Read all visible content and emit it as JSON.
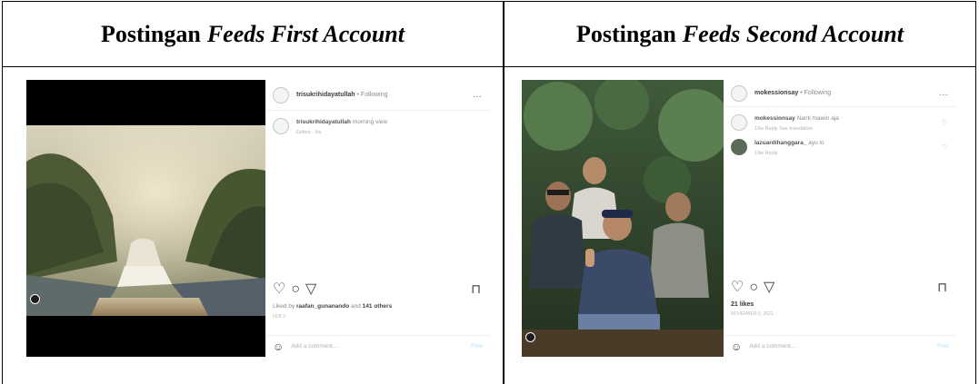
{
  "headers": {
    "col1_prefix": "Postingan",
    "col1_italic": "Feeds First Account",
    "col2_prefix": "Postingan",
    "col2_italic": "Feeds Second Account"
  },
  "post1": {
    "username": "trisukrihidayatullah",
    "follow_status": "Following",
    "more": "…",
    "caption_user": "trisukrihidayatullah",
    "caption_text": "morning view",
    "caption_meta": "Edited · 5w",
    "liked_prefix": "Liked by",
    "liked_user": "raafan_gunanando",
    "liked_mid": "and",
    "liked_others": "141 others",
    "date": "FEB 3",
    "add_comment_placeholder": "Add a comment…",
    "post_button": "Post"
  },
  "post2": {
    "username": "mokessionsay",
    "follow_status": "Following",
    "more": "…",
    "comment1_user": "mokessionsay",
    "comment1_text": "Nanti mawin aja",
    "comment1_meta": "19w  Reply  See translation",
    "comment2_user": "lazuardihanggara_",
    "comment2_text": "ayu lo",
    "comment2_meta": "19w  Reply",
    "likes": "21 likes",
    "date": "NOVEMBER 5, 2021",
    "add_comment_placeholder": "Add a comment…",
    "post_button": "Post"
  },
  "icons": {
    "heart": "heart-outline-icon",
    "comment": "comment-bubble-icon",
    "share": "paper-plane-icon",
    "save": "bookmark-icon",
    "emoji": "smiley-icon"
  }
}
